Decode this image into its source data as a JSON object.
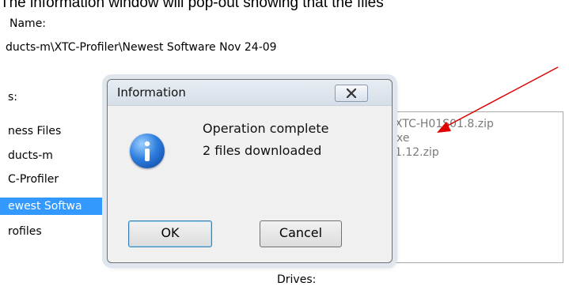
{
  "caption": "The information window will pop-out showing that the files",
  "name_label": "Name:",
  "path": "ducts-m\\XTC-Profiler\\Newest Software Nov 24-09",
  "dirs_label": "s:",
  "tree": [
    {
      "label": "ness Files",
      "selected": false
    },
    {
      "label": "ducts-m",
      "selected": false
    },
    {
      "label": "C-Profiler",
      "selected": false
    },
    {
      "label": "ewest Softwa",
      "selected": true
    },
    {
      "label": "rofiles",
      "selected": false
    }
  ],
  "files": [
    "XTC-H01S01.8.zip",
    "xe",
    "1.12.zip"
  ],
  "drives_label": "Drives:",
  "dialog": {
    "title": "Information",
    "message_line1": "Operation complete",
    "message_line2": "2 files downloaded",
    "ok_label": "OK",
    "cancel_label": "Cancel",
    "icon": "info-icon"
  },
  "colors": {
    "selection": "#3399ff",
    "arrow": "#e00000"
  }
}
